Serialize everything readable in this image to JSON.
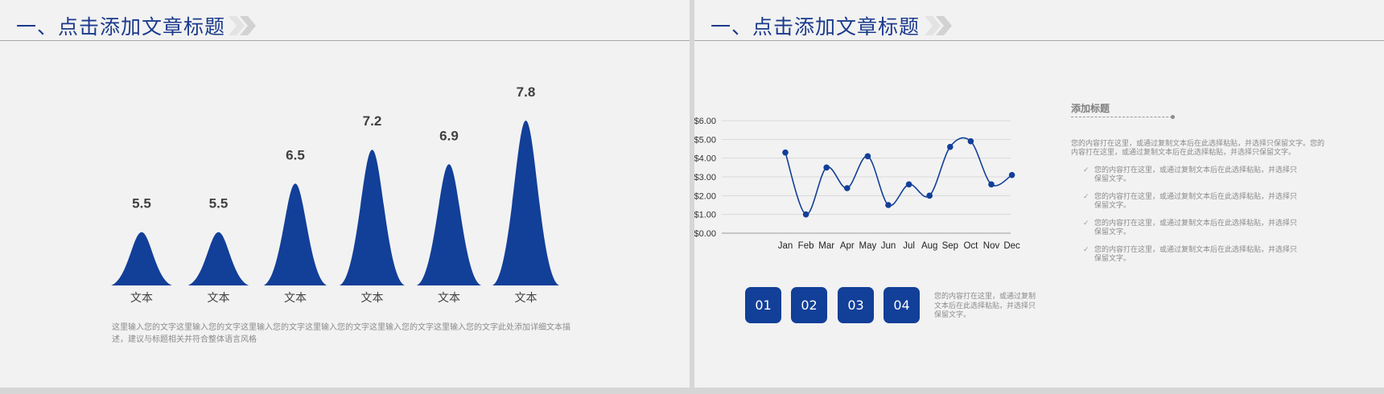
{
  "slides": [
    {
      "title": "一、点击添加文章标题",
      "description": "这里输入您的文字这里输入您的文字这里输入您的文字这里输入您的文字这里输入您的文字这里输入您的文字此处添加详细文本描述，建议与标题相关并符合整体语言风格"
    },
    {
      "title": "一、点击添加文章标题",
      "badges": [
        "01",
        "02",
        "03",
        "04"
      ],
      "badge_description": "您的内容打在这里，或通过复制文本后在此选择粘贴，并选择只保留文字。",
      "side_heading": "添加标题",
      "side_intro": "您的内容打在这里，或通过复制文本后在此选择粘贴，并选择只保留文字。您的内容打在这里，或通过复制文本后在此选择粘贴，并选择只保留文字。",
      "side_items": [
        "您的内容打在这里，或通过复制文本后在此选择粘贴，并选择只保留文字。",
        "您的内容打在这里，或通过复制文本后在此选择粘贴，并选择只保留文字。",
        "您的内容打在这里，或通过复制文本后在此选择粘贴，并选择只保留文字。",
        "您的内容打在这里，或通过复制文本后在此选择粘贴，并选择只保留文字。"
      ]
    }
  ],
  "colors": {
    "accent": "#123f98",
    "title": "#1b3a8c",
    "chevron": "#d8d8d8",
    "text_muted": "#8b8b8b"
  },
  "icons": {
    "chevron": "double-chevron-icon",
    "check": "check-icon"
  },
  "check_glyph": "✓",
  "chart_data": [
    {
      "type": "area",
      "categories": [
        "文本",
        "文本",
        "文本",
        "文本",
        "文本",
        "文本"
      ],
      "values": [
        5.5,
        5.5,
        6.5,
        7.2,
        6.9,
        7.8
      ],
      "data_labels": [
        "5.5",
        "5.5",
        "6.5",
        "7.2",
        "6.9",
        "7.8"
      ],
      "ylim": [
        0,
        8
      ],
      "grid": false,
      "color": "#123f98"
    },
    {
      "type": "line",
      "categories": [
        "Jan",
        "Feb",
        "Mar",
        "Apr",
        "May",
        "Jun",
        "Jul",
        "Aug",
        "Sep",
        "Oct",
        "Nov",
        "Dec"
      ],
      "values": [
        4.3,
        1.0,
        3.5,
        2.4,
        4.1,
        1.5,
        2.6,
        2.0,
        4.6,
        4.9,
        2.6,
        3.1
      ],
      "yticks": [
        "$0.00",
        "$1.00",
        "$2.00",
        "$3.00",
        "$4.00",
        "$5.00",
        "$6.00"
      ],
      "ylim": [
        0,
        6
      ],
      "grid": true,
      "smooth": true,
      "color": "#123f98"
    }
  ]
}
